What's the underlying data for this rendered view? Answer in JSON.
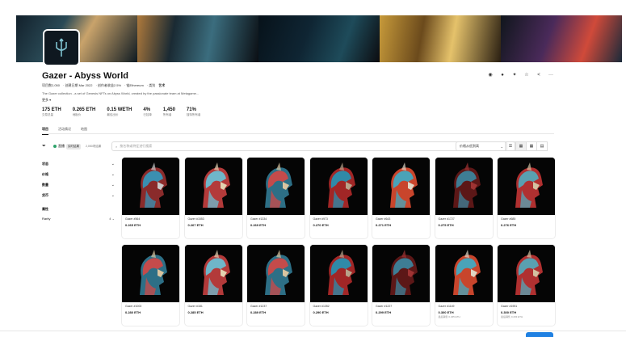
{
  "collection": {
    "title": "Gazer - Abyss World",
    "meta": [
      "项目数2,050",
      "· 创建日期 Mar 2022",
      "· 创作者收益2.5%",
      "· 链Ethereum",
      "· 类别",
      "艺术"
    ],
    "description": "The Gazer collection - a set of Genesis NFTs on Abyss World, created by the passionate team at Metagame...",
    "more_label": "更多 ▾"
  },
  "stats": [
    {
      "value": "175 ETH",
      "label": "交易总量"
    },
    {
      "value": "0.265 ETH",
      "label": "地板价"
    },
    {
      "value": "0.15 WETH",
      "label": "最佳出价"
    },
    {
      "value": "4%",
      "label": "已挂单"
    },
    {
      "value": "1,450",
      "label": "所有者"
    },
    {
      "value": "71%",
      "label": "独特所有者"
    }
  ],
  "actions": [
    {
      "name": "website-icon",
      "glyph": "◉"
    },
    {
      "name": "discord-icon",
      "glyph": "●"
    },
    {
      "name": "twitter-icon",
      "glyph": "✦"
    },
    {
      "name": "star-icon",
      "glyph": "☆"
    },
    {
      "name": "share-icon",
      "glyph": "<"
    },
    {
      "name": "more-icon",
      "glyph": "···"
    }
  ],
  "tabs": [
    "项目",
    "活动情况",
    "地图"
  ],
  "toolbar": {
    "live_label": "直播",
    "live_badge": "实时结果",
    "count": "2,050项结果",
    "search_placeholder": "按名称或特征进行搜索",
    "sort_label": "价格从低到高"
  },
  "sidebar": {
    "filters": [
      "状态",
      "价格",
      "数量",
      "货币"
    ],
    "section": "属性",
    "trait": {
      "name": "Rarity",
      "count": "4"
    }
  },
  "cards": [
    {
      "name": "Gazer #564",
      "price": "0.265 ETH",
      "last": "",
      "variant": 0
    },
    {
      "name": "Gazer #1553",
      "price": "0.267 ETH",
      "last": "",
      "variant": 1
    },
    {
      "name": "Gazer #1334",
      "price": "0.269 ETH",
      "last": "",
      "variant": 2
    },
    {
      "name": "Gazer #973",
      "price": "0.270 ETH",
      "last": "",
      "variant": 3
    },
    {
      "name": "Gazer #643",
      "price": "0.271 ETH",
      "last": "",
      "variant": 4
    },
    {
      "name": "Gazer #1727",
      "price": "0.275 ETH",
      "last": "",
      "variant": 5
    },
    {
      "name": "Gazer #685",
      "price": "0.276 ETH",
      "last": "",
      "variant": 6
    },
    {
      "name": "Gazer #1003",
      "price": "0.280 ETH",
      "last": "",
      "variant": 2
    },
    {
      "name": "Gazer #181",
      "price": "0.285 ETH",
      "last": "",
      "variant": 1
    },
    {
      "name": "Gazer #1237",
      "price": "0.289 ETH",
      "last": "",
      "variant": 2
    },
    {
      "name": "Gazer #1352",
      "price": "0.290 ETH",
      "last": "",
      "variant": 3
    },
    {
      "name": "Gazer #1227",
      "price": "0.299 ETH",
      "last": "",
      "variant": 5
    },
    {
      "name": "Gazer #1149",
      "price": "0.300 ETH",
      "last": "最后销售 0.235 ETH",
      "variant": 4
    },
    {
      "name": "Gazer #1951",
      "price": "0.300 ETH",
      "last": "最后销售 0.203 ETH",
      "variant": 6
    }
  ],
  "colors": {
    "accent": "#2081e2",
    "live_dot": "#2ea36b"
  }
}
